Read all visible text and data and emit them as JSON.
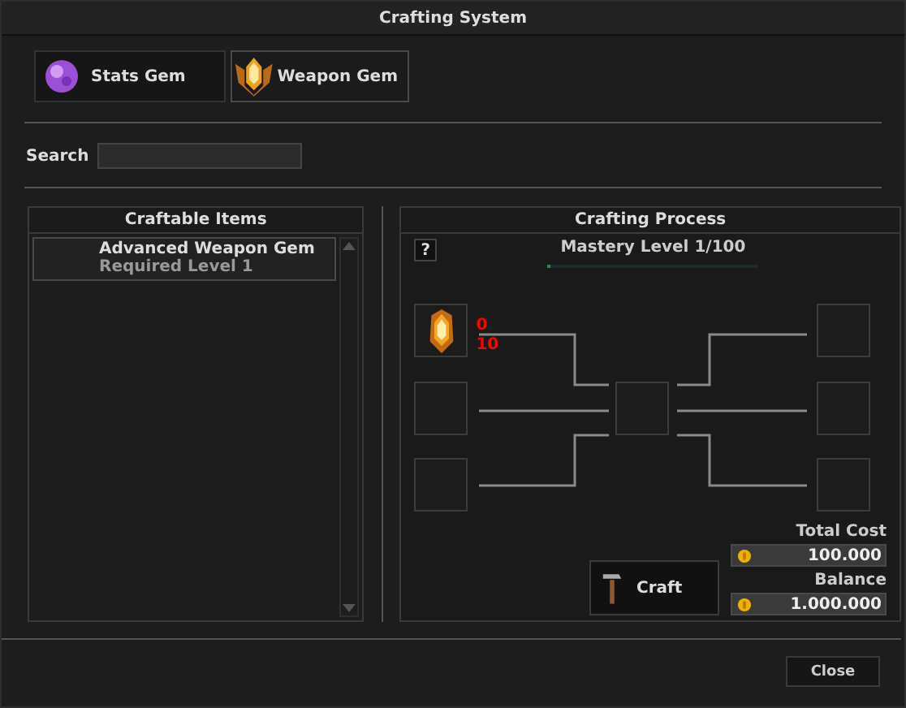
{
  "window": {
    "title": "Crafting System"
  },
  "tabs": [
    {
      "label": "Stats Gem",
      "kind": "stats",
      "selected": false
    },
    {
      "label": "Weapon Gem",
      "kind": "weapon",
      "selected": true
    }
  ],
  "search": {
    "label": "Search"
  },
  "craftable_items": {
    "title": "Craftable Items",
    "items": [
      {
        "name": "Advanced Weapon Gem",
        "requirement": "Required Level 1",
        "selected": true
      }
    ]
  },
  "crafting_process": {
    "title": "Crafting Process",
    "help": "?",
    "mastery": {
      "text": "Mastery Level 1/100",
      "level": 0.01
    },
    "materials": [
      {
        "kind": "weapon-gem",
        "owned": "0",
        "required": "10"
      }
    ],
    "craft_button": "Craft",
    "total_cost": {
      "label": "Total Cost",
      "value": "100.000"
    },
    "balance": {
      "label": "Balance",
      "value": "1.000.000"
    }
  },
  "close_button": "Close"
}
